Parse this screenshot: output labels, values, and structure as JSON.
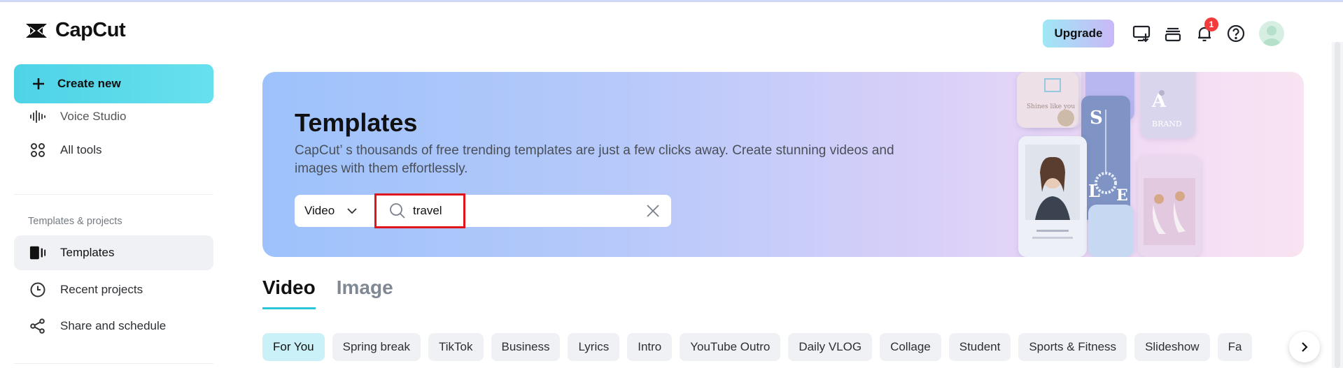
{
  "app": {
    "name": "CapCut"
  },
  "header": {
    "upgrade_label": "Upgrade",
    "notification_count": "1",
    "icons": [
      "desktop-download-icon",
      "stack-icon",
      "bell-icon",
      "help-icon",
      "avatar"
    ]
  },
  "sidebar": {
    "create_label": "Create new",
    "items_top": [
      {
        "label": "Voice Studio",
        "icon": "waveform-icon"
      },
      {
        "label": "All tools",
        "icon": "grid-icon"
      }
    ],
    "section_title": "Templates & projects",
    "items_section": [
      {
        "label": "Templates",
        "icon": "templates-icon",
        "active": true
      },
      {
        "label": "Recent projects",
        "icon": "clock-icon"
      },
      {
        "label": "Share and schedule",
        "icon": "share-icon"
      }
    ]
  },
  "banner": {
    "title": "Templates",
    "description": "CapCut’ s thousands of free trending templates are just a few clicks away. Create stunning videos and images with them effortlessly.",
    "type_value": "Video",
    "search_value": "travel",
    "collage_texts": [
      "Shines like you",
      "S",
      "A",
      "L",
      "E",
      "BRAND"
    ]
  },
  "tabs": [
    {
      "label": "Video",
      "active": true
    },
    {
      "label": "Image",
      "active": false
    }
  ],
  "chips": [
    "For You",
    "Spring break",
    "TikTok",
    "Business",
    "Lyrics",
    "Intro",
    "YouTube Outro",
    "Daily VLOG",
    "Collage",
    "Student",
    "Sports & Fitness",
    "Slideshow",
    "Fa"
  ],
  "colors": {
    "accent": "#2cc4d8",
    "create_button": "#4ed3e6",
    "highlight_box": "#e0141c",
    "badge": "#f33b3b"
  }
}
